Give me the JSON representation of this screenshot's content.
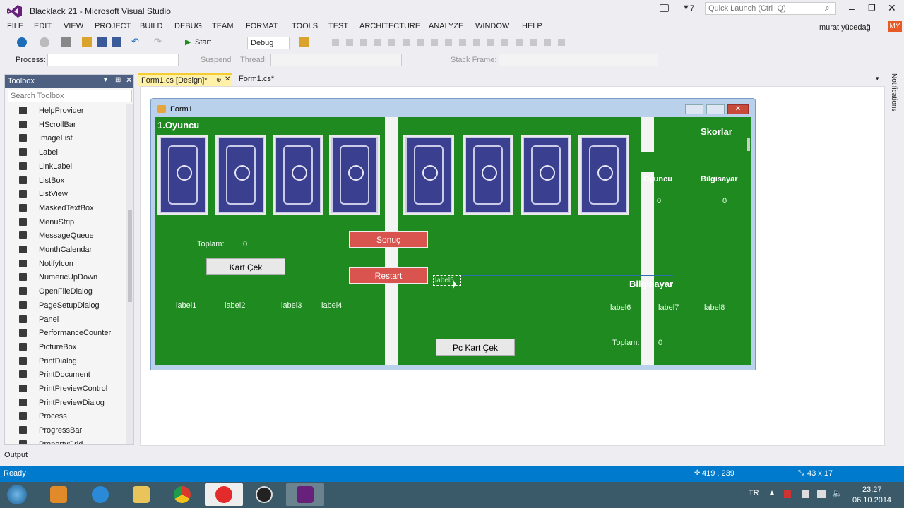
{
  "window": {
    "title": "Blacklack 21 - Microsoft Visual Studio"
  },
  "titlebar_right": {
    "notification_count": "7",
    "quick_launch_placeholder": "Quick Launch (Ctrl+Q)",
    "user": "murat yücedağ",
    "user_initials": "MY"
  },
  "menu": [
    "FILE",
    "EDIT",
    "VIEW",
    "PROJECT",
    "BUILD",
    "DEBUG",
    "TEAM",
    "FORMAT",
    "TOOLS",
    "TEST",
    "ARCHITECTURE",
    "ANALYZE",
    "WINDOW",
    "HELP"
  ],
  "toolbar": {
    "start_label": "Start",
    "config": "Debug"
  },
  "toolbar2": {
    "process_label": "Process:",
    "suspend_label": "Suspend",
    "thread_label": "Thread:",
    "stack_frame_label": "Stack Frame:"
  },
  "toolbox": {
    "title": "Toolbox",
    "search_placeholder": "Search Toolbox",
    "items": [
      "HelpProvider",
      "HScrollBar",
      "ImageList",
      "Label",
      "LinkLabel",
      "ListBox",
      "ListView",
      "MaskedTextBox",
      "MenuStrip",
      "MessageQueue",
      "MonthCalendar",
      "NotifyIcon",
      "NumericUpDown",
      "OpenFileDialog",
      "PageSetupDialog",
      "Panel",
      "PerformanceCounter",
      "PictureBox",
      "PrintDialog",
      "PrintDocument",
      "PrintPreviewControl",
      "PrintPreviewDialog",
      "Process",
      "ProgressBar",
      "PropertyGrid"
    ]
  },
  "tabs": [
    {
      "label": "Form1.cs [Design]*"
    },
    {
      "label": "Form1.cs*"
    }
  ],
  "side_panel_label": "Notifications",
  "form": {
    "caption": "Form1",
    "player_title": "1.Oyuncu",
    "scores_title": "Skorlar",
    "score_player_label": "Oyuncu",
    "score_pc_label": "Bilgisayar",
    "score_player_value": "0",
    "score_pc_value": "0",
    "total_label": "Toplam:",
    "total_value": "0",
    "draw_button": "Kart Çek",
    "result_button": "Sonuç",
    "restart_button": "Restart",
    "selected_label": "label5",
    "pc_title": "Bilgisayar",
    "labels_player": [
      "label1",
      "label2",
      "label3",
      "label4"
    ],
    "labels_pc": [
      "label6",
      "label7",
      "label8"
    ],
    "pc_total_label": "Toplam:",
    "pc_total_value": "0",
    "pc_draw_button": "Pc Kart Çek"
  },
  "output": {
    "label": "Output"
  },
  "status": {
    "text": "Ready",
    "position": "419 , 239",
    "size": "43 x 17"
  },
  "taskbar": {
    "lang": "TR",
    "time": "23:27",
    "date": "06.10.2014"
  },
  "colors": {
    "accent": "#007acc",
    "form_green": "#1f8a20",
    "vs_purple": "#68217a"
  }
}
